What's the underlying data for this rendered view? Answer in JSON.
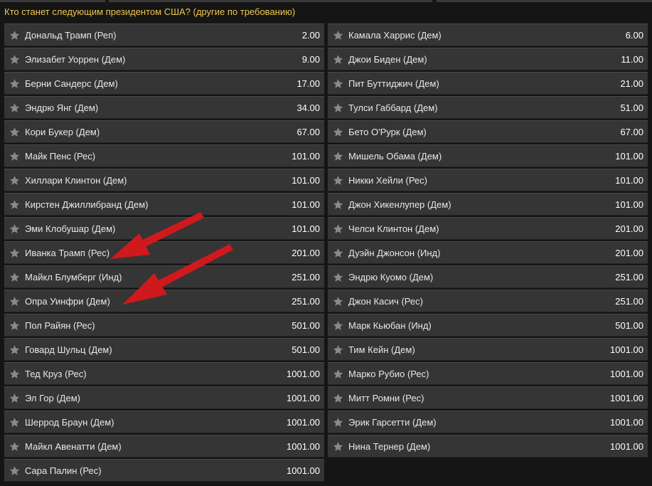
{
  "market": {
    "title": "Кто станет следующим президентом США? (другие по требованию)"
  },
  "colors": {
    "background": "#151515",
    "cell": "#353535",
    "title": "#f0c74a",
    "star": "#8a8a8a",
    "arrow": "#d0191c"
  },
  "icons": {
    "favorite": "star-icon"
  },
  "left_column": [
    {
      "name": "Дональд Трамп (Реп)",
      "odds": "2.00"
    },
    {
      "name": "Элизабет Уоррен (Дем)",
      "odds": "9.00"
    },
    {
      "name": "Берни Сандерс (Дем)",
      "odds": "17.00"
    },
    {
      "name": "Эндрю Янг (Дем)",
      "odds": "34.00"
    },
    {
      "name": "Кори Букер (Дем)",
      "odds": "67.00"
    },
    {
      "name": "Майк Пенс (Рес)",
      "odds": "101.00"
    },
    {
      "name": "Хиллари Клинтон (Дем)",
      "odds": "101.00"
    },
    {
      "name": "Кирстен Джиллибранд (Дем)",
      "odds": "101.00"
    },
    {
      "name": "Эми Клобушар (Дем)",
      "odds": "101.00"
    },
    {
      "name": "Иванка Трамп (Рес)",
      "odds": "201.00"
    },
    {
      "name": "Майкл Блумберг (Инд)",
      "odds": "251.00"
    },
    {
      "name": "Опра Уинфри (Дем)",
      "odds": "251.00"
    },
    {
      "name": "Пол Райян (Рес)",
      "odds": "501.00"
    },
    {
      "name": "Говард Шульц (Дем)",
      "odds": "501.00"
    },
    {
      "name": "Тед Круз (Рес)",
      "odds": "1001.00"
    },
    {
      "name": "Эл Гор (Дем)",
      "odds": "1001.00"
    },
    {
      "name": "Шеррод Браун (Дем)",
      "odds": "1001.00"
    },
    {
      "name": "Майкл Авенатти (Дем)",
      "odds": "1001.00"
    },
    {
      "name": "Сара Палин (Рес)",
      "odds": "1001.00"
    }
  ],
  "right_column": [
    {
      "name": "Камала Харрис (Дем)",
      "odds": "6.00"
    },
    {
      "name": "Джои Биден (Дем)",
      "odds": "11.00"
    },
    {
      "name": "Пит Буттиджич (Дем)",
      "odds": "21.00"
    },
    {
      "name": "Тулси Габбард (Дем)",
      "odds": "51.00"
    },
    {
      "name": "Бето О'Рурк (Дем)",
      "odds": "67.00"
    },
    {
      "name": "Мишель Обама (Дем)",
      "odds": "101.00"
    },
    {
      "name": "Никки Хейли (Рес)",
      "odds": "101.00"
    },
    {
      "name": "Джон Хикенлупер (Дем)",
      "odds": "101.00"
    },
    {
      "name": "Челси Клинтон (Дем)",
      "odds": "201.00"
    },
    {
      "name": "Дуэйн Джонсон (Инд)",
      "odds": "201.00"
    },
    {
      "name": "Эндрю Куомо (Дем)",
      "odds": "251.00"
    },
    {
      "name": "Джон Касич (Рес)",
      "odds": "251.00"
    },
    {
      "name": "Марк Кьюбан (Инд)",
      "odds": "501.00"
    },
    {
      "name": "Тим Кейн (Дем)",
      "odds": "1001.00"
    },
    {
      "name": "Марко Рубио (Рес)",
      "odds": "1001.00"
    },
    {
      "name": "Митт Ромни (Рес)",
      "odds": "1001.00"
    },
    {
      "name": "Эрик Гарсетти (Дем)",
      "odds": "1001.00"
    },
    {
      "name": "Нина Тернер (Дем)",
      "odds": "1001.00"
    }
  ]
}
